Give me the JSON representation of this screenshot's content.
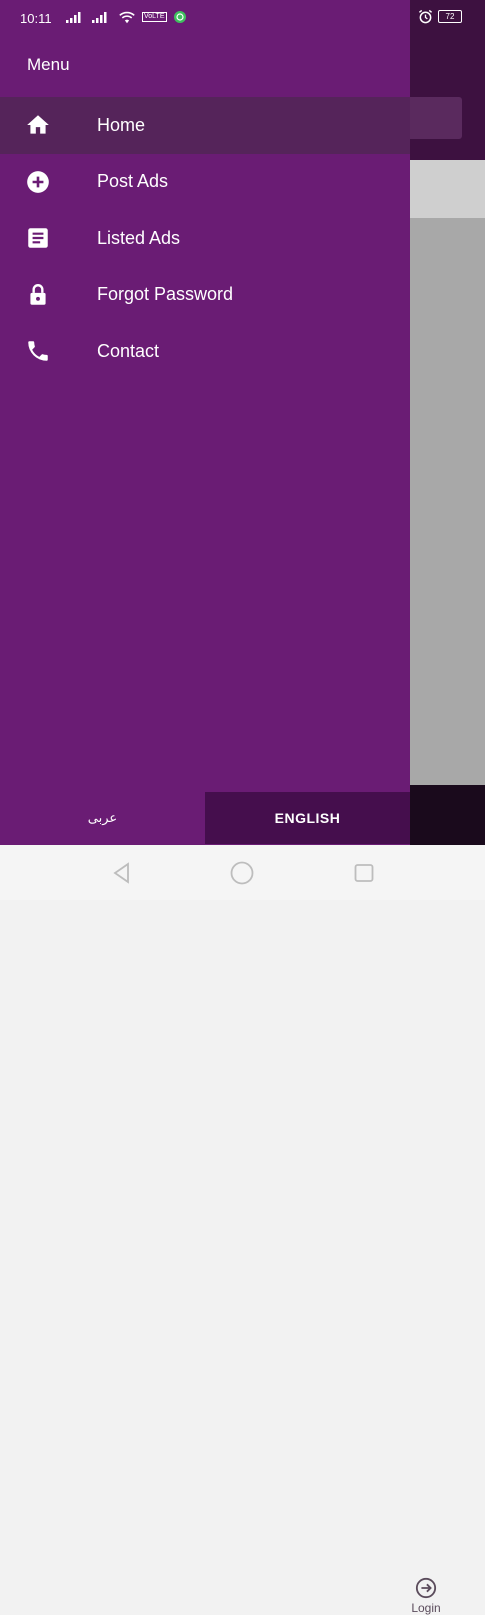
{
  "status_bar": {
    "time": "10:11",
    "volte_label": "VoLTE",
    "battery": "72"
  },
  "drawer": {
    "title": "Menu",
    "items": [
      {
        "label": "Home",
        "icon": "home-icon",
        "active": true
      },
      {
        "label": "Post Ads",
        "icon": "add-circle-icon",
        "active": false
      },
      {
        "label": "Listed Ads",
        "icon": "article-icon",
        "active": false
      },
      {
        "label": "Forgot Password",
        "icon": "lock-icon",
        "active": false
      },
      {
        "label": "Contact",
        "icon": "phone-icon",
        "active": false
      }
    ]
  },
  "language": {
    "arabic_label": "عربى",
    "english_label": "ENGLISH"
  },
  "background_app": {
    "login_label": "Login"
  },
  "colors": {
    "drawer_bg": "#6a1c74",
    "active_item_bg": "#55245a",
    "english_button_bg": "#450e4d"
  }
}
